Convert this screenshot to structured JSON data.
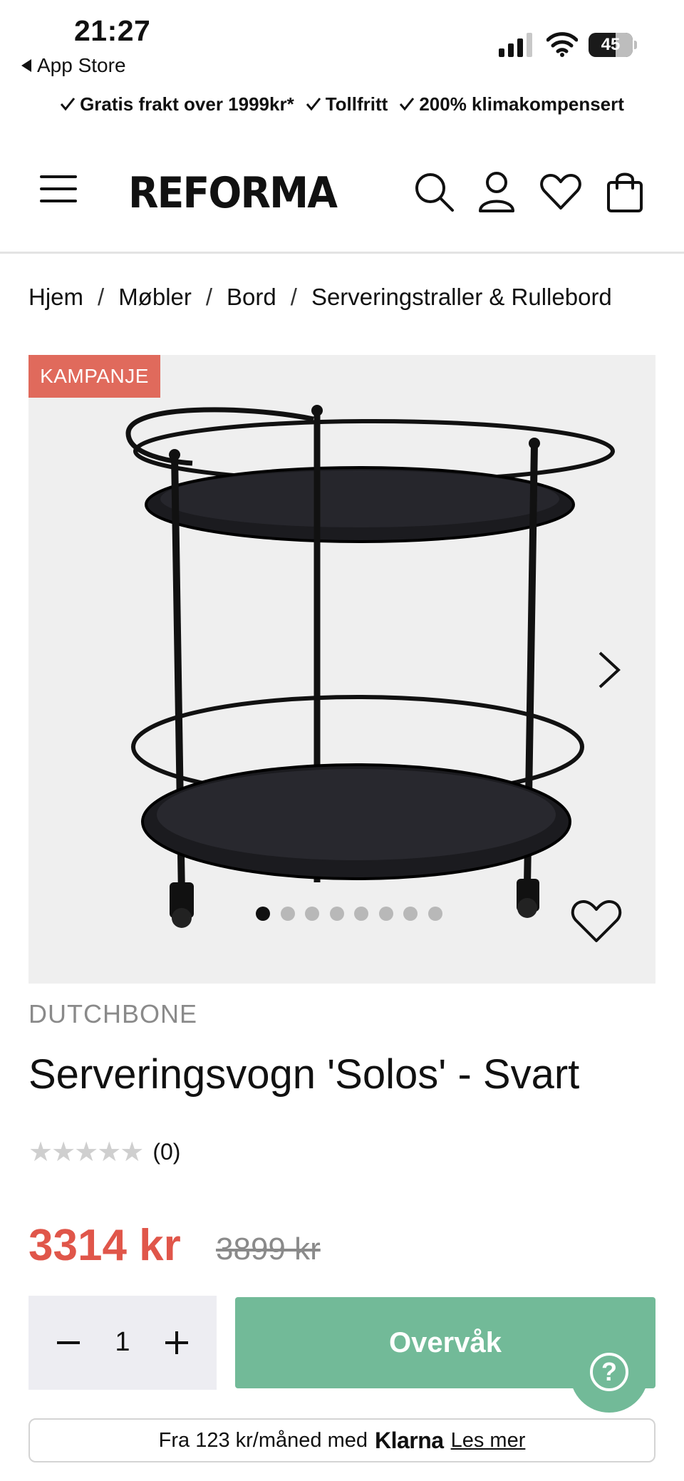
{
  "status_bar": {
    "time": "21:27",
    "back_label": "App Store",
    "battery": "45"
  },
  "usp": [
    "Gratis frakt over 1999kr*",
    "Tollfritt",
    "200% klimakompensert"
  ],
  "header": {
    "logo": "REFORMA",
    "icons": [
      "menu-icon",
      "search-icon",
      "account-icon",
      "heart-icon",
      "bag-icon"
    ]
  },
  "breadcrumb": [
    "Hjem",
    "Møbler",
    "Bord",
    "Serveringstraller & Rullebord"
  ],
  "gallery": {
    "badge": "KAMPANJE",
    "image_count": 8,
    "active_index": 0
  },
  "product": {
    "brand": "DUTCHBONE",
    "title": "Serveringsvogn 'Solos' - Svart",
    "rating_stars": "★★★★★",
    "rating_count": "(0)",
    "price": "3314 kr",
    "old_price": "3899 kr"
  },
  "purchase": {
    "quantity": "1",
    "cta_label": "Overvåk",
    "help_label": "?"
  },
  "klarna": {
    "prefix": "Fra 123 kr/måned med",
    "brand": "Klarna",
    "link": "Les mer"
  },
  "colors": {
    "accent_green": "#72ba98",
    "sale_red": "#e0564a",
    "badge_red": "#e06a5c"
  }
}
